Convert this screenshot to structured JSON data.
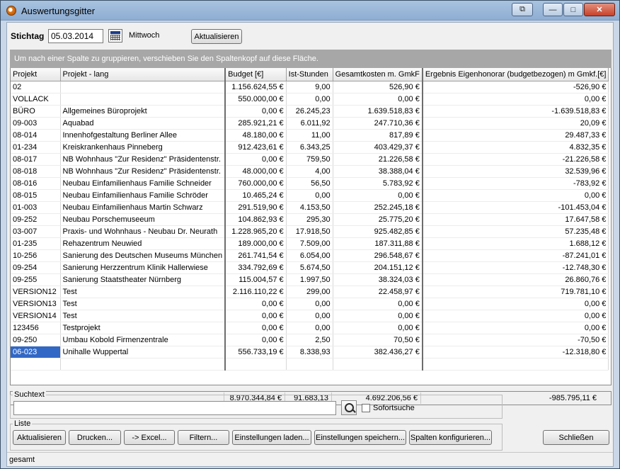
{
  "window": {
    "title": "Auswertungsgitter",
    "restore_symbol": "⧉",
    "minimize_symbol": "—",
    "maximize_symbol": "□",
    "close_symbol": "✕"
  },
  "toolbar": {
    "date_label": "Stichtag",
    "date_value": "05.03.2014",
    "weekday": "Mittwoch",
    "refresh_label": "Aktualisieren"
  },
  "grid": {
    "group_hint": "Um nach einer Spalte zu gruppieren, verschieben Sie den Spaltenkopf auf diese Fläche.",
    "columns": [
      "Projekt",
      "Projekt - lang",
      "Budget [€]",
      "Ist-Stunden",
      "Gesamtkosten m. GmkF",
      "Ergebnis Eigenhonorar (budgetbezogen) m Gmkf.[€]"
    ],
    "rows": [
      [
        "02",
        "",
        "1.156.624,55 €",
        "9,00",
        "526,90 €",
        "-526,90 €"
      ],
      [
        "VOLLACK",
        "",
        "550.000,00 €",
        "0,00",
        "0,00 €",
        "0,00 €"
      ],
      [
        "BÜRO",
        "Allgemeines Büroprojekt",
        "0,00 €",
        "26.245,23",
        "1.639.518,83 €",
        "-1.639.518,83 €"
      ],
      [
        "09-003",
        "Aquabad",
        "285.921,21 €",
        "6.011,92",
        "247.710,36 €",
        "20,09 €"
      ],
      [
        "08-014",
        "Innenhofgestaltung Berliner Allee",
        "48.180,00 €",
        "11,00",
        "817,89 €",
        "29.487,33 €"
      ],
      [
        "01-234",
        "Kreiskrankenhaus Pinneberg",
        "912.423,61 €",
        "6.343,25",
        "403.429,37 €",
        "4.832,35 €"
      ],
      [
        "08-017",
        "NB Wohnhaus \"Zur Residenz\" Präsidentenstr.",
        "0,00 €",
        "759,50",
        "21.226,58 €",
        "-21.226,58 €"
      ],
      [
        "08-018",
        "NB Wohnhaus \"Zur Residenz\" Präsidentenstr.",
        "48.000,00 €",
        "4,00",
        "38.388,04 €",
        "32.539,96 €"
      ],
      [
        "08-016",
        "Neubau Einfamilienhaus Familie Schneider",
        "760.000,00 €",
        "56,50",
        "5.783,92 €",
        "-783,92 €"
      ],
      [
        "08-015",
        "Neubau Einfamilienhaus Familie Schröder",
        "10.465,24 €",
        "0,00",
        "0,00 €",
        "0,00 €"
      ],
      [
        "01-003",
        "Neubau Einfamilienhaus Martin Schwarz",
        "291.519,90 €",
        "4.153,50",
        "252.245,18 €",
        "-101.453,04 €"
      ],
      [
        "09-252",
        "Neubau Porschemuseeum",
        "104.862,93 €",
        "295,30",
        "25.775,20 €",
        "17.647,58 €"
      ],
      [
        "03-007",
        "Praxis- und Wohnhaus - Neubau Dr. Neurath",
        "1.228.965,20 €",
        "17.918,50",
        "925.482,85 €",
        "57.235,48 €"
      ],
      [
        "01-235",
        "Rehazentrum Neuwied",
        "189.000,00 €",
        "7.509,00",
        "187.311,88 €",
        "1.688,12 €"
      ],
      [
        "10-256",
        "Sanierung des Deutschen Museums München",
        "261.741,54 €",
        "6.054,00",
        "296.548,67 €",
        "-87.241,01 €"
      ],
      [
        "09-254",
        "Sanierung Herzzentrum Klinik Hallerwiese",
        "334.792,69 €",
        "5.674,50",
        "204.151,12 €",
        "-12.748,30 €"
      ],
      [
        "09-255",
        "Sanierung Staatstheater Nürnberg",
        "115.004,57 €",
        "1.997,50",
        "38.324,03 €",
        "26.860,76 €"
      ],
      [
        "VERSION12",
        "Test",
        "2.116.110,22 €",
        "299,00",
        "22.458,97 €",
        "719.781,10 €"
      ],
      [
        "VERSION13",
        "Test",
        "0,00 €",
        "0,00",
        "0,00 €",
        "0,00 €"
      ],
      [
        "VERSION14",
        "Test",
        "0,00 €",
        "0,00",
        "0,00 €",
        "0,00 €"
      ],
      [
        "123456",
        "Testprojekt",
        "0,00 €",
        "0,00",
        "0,00 €",
        "0,00 €"
      ],
      [
        "09-250",
        "Umbau Kobold Firmenzentrale",
        "0,00 €",
        "2,50",
        "70,50 €",
        "-70,50 €"
      ],
      [
        "06-023",
        "Unihalle Wuppertal",
        "556.733,19 €",
        "8.338,93",
        "382.436,27 €",
        "-12.318,80 €"
      ]
    ],
    "selected_row": 22,
    "totals": [
      "8.970.344,84 €",
      "91.683,13",
      "4.692.206,56 €",
      "-985.795,11 €"
    ]
  },
  "search": {
    "legend": "Suchtext",
    "value": "",
    "instant_label": "Sofortsuche",
    "instant_checked": false
  },
  "list": {
    "legend": "Liste",
    "buttons": [
      "Aktualisieren",
      "Drucken...",
      "-> Excel...",
      "Filtern...",
      "Einstellungen laden...",
      "Einstellungen speichern...",
      "Spalten konfigurieren..."
    ],
    "close_label": "Schließen"
  },
  "status": {
    "text": "gesamt"
  }
}
